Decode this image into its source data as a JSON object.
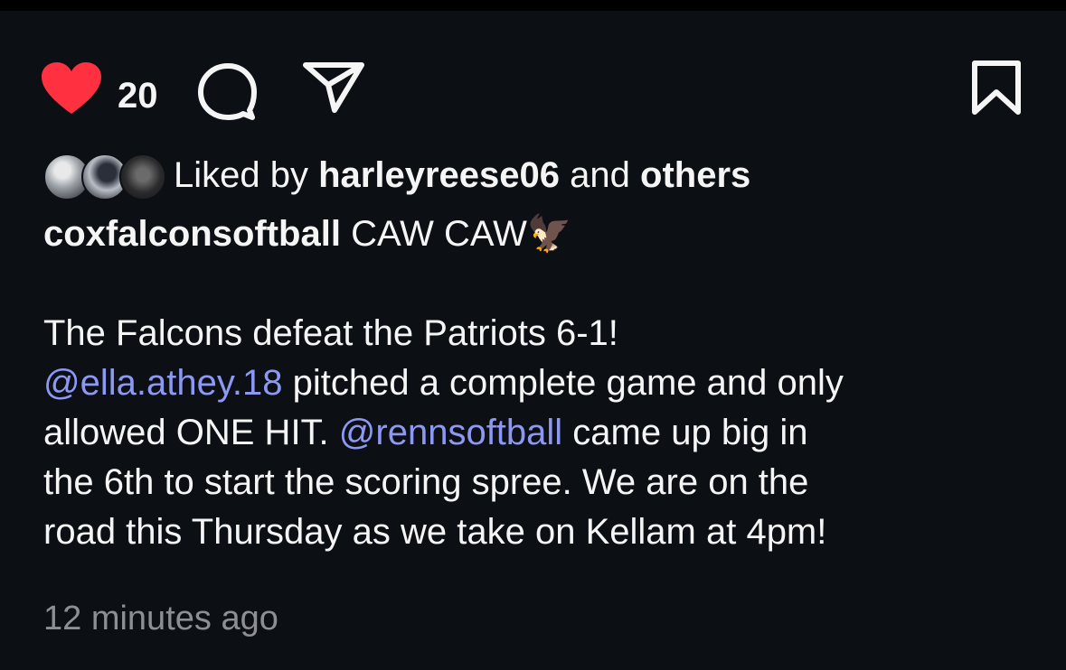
{
  "post": {
    "like_count": "20",
    "liked_by": {
      "prefix": "Liked by",
      "user": "harleyreese06",
      "joiner": "and",
      "others": "others"
    },
    "caption": {
      "author": "coxfalconsoftball",
      "headline": "CAW CAW",
      "emoji": "🦅",
      "line1": "The Falcons defeat the Patriots 6-1!",
      "mention1": "@ella.athey.18",
      "line2_rest": " pitched a complete game and only",
      "line3_start": "allowed ONE HIT. ",
      "mention2": "@rennsoftball",
      "line3_rest": " came up big in",
      "line4": "the 6th to start the scoring spree. We are on the",
      "line5": "road this Thursday as we take on Kellam at 4pm!"
    },
    "timestamp": "12 minutes ago"
  },
  "icons": {
    "like": "heart-filled-icon",
    "comment": "comment-bubble-icon",
    "share": "paper-plane-icon",
    "save": "bookmark-icon"
  },
  "colors": {
    "background": "#0c0f14",
    "like_red": "#ff3040",
    "mention": "#8d98f3",
    "timestamp": "#8e8f95"
  }
}
